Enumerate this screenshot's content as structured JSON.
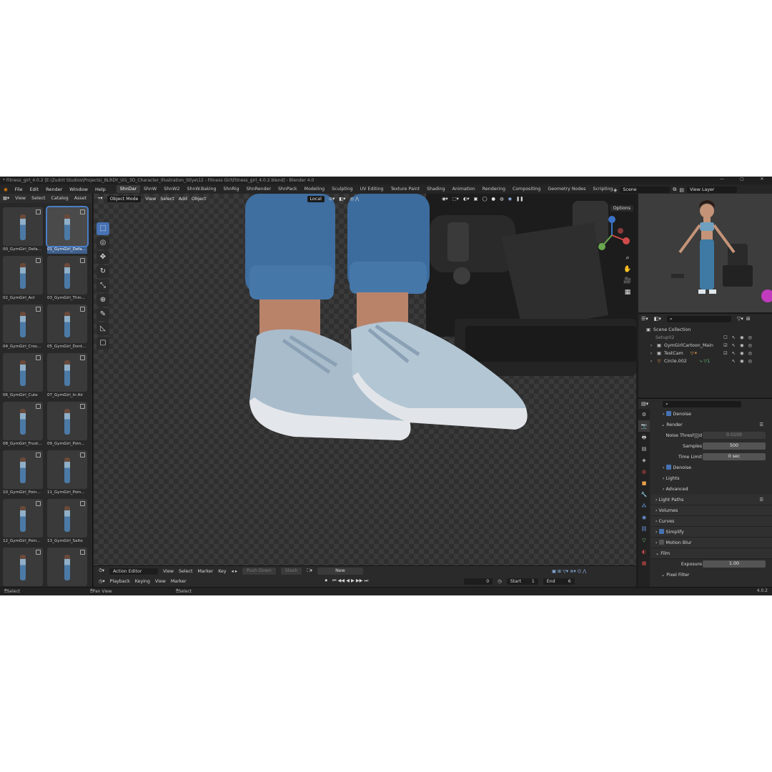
{
  "titlebar": {
    "title": "* Fitness_girl_4.0.2 [E:\\Zudrit Studios\\Projects\\_BLRDY_\\01_3D_Character_Illustration_Stlye\\12 - Fitness Girl\\Fitness_girl_4.0.2.blend] - Blender 4.0"
  },
  "menu": [
    "File",
    "Edit",
    "Render",
    "Window",
    "Help"
  ],
  "workspaces": [
    "ShnDar",
    "ShnW",
    "ShnW2",
    "ShnW.Baking",
    "ShnRig",
    "ShnRender",
    "ShnPack",
    "Modeling",
    "Sculpting",
    "UV Editing",
    "Texture Paint",
    "Shading",
    "Animation",
    "Rendering",
    "Compositing",
    "Geometry Nodes",
    "Scripting"
  ],
  "active_workspace": "ShnDar",
  "scene": {
    "scene_label": "Scene",
    "view_layer": "View Layer"
  },
  "asset_browser": {
    "menus": [
      "View",
      "Select",
      "Catalog",
      "Asset"
    ],
    "assets": [
      "00_GymGirl_Defa...",
      "01_GymGirl_Defa...",
      "02_GymGirl_Act",
      "03_GymGirl_Thin...",
      "04_GymGirl_Cros...",
      "05_GymGirl_Dont...",
      "06_GymGirl_Cute",
      "07_GymGirl_In Air",
      "08_GymGirl_Frust...",
      "09_GymGirl_Poin...",
      "10_GymGirl_Poin...",
      "11_GymGirl_Poin...",
      "12_GymGirl_Poin...",
      "13_GymGirl_Salto",
      "",
      ""
    ],
    "selected_index": 1
  },
  "viewport": {
    "mode": "Object Mode",
    "menus": [
      "View",
      "Select",
      "Add",
      "Object"
    ],
    "transform": "Local",
    "options": "Options"
  },
  "timeline": {
    "editor": "Action Editor",
    "menus": [
      "View",
      "Select",
      "Marker",
      "Key"
    ],
    "push_down": "Push Down",
    "stash": "Stash",
    "new": "New",
    "row2_menus": [
      "Playback",
      "Keying",
      "View",
      "Marker"
    ],
    "current_frame": "0",
    "start_label": "Start",
    "start": "1",
    "end_label": "End",
    "end": "6"
  },
  "outliner": {
    "root": "Scene Collection",
    "items": [
      "Setup02",
      "GymGirlCartoon_Main",
      "TestCam",
      "Circle.002"
    ]
  },
  "properties": {
    "rows": {
      "denoise1": "Denoise",
      "render": "Render",
      "noise_threshold_label": "Noise Threshold",
      "noise_threshold": "0.0100",
      "samples_label": "Samples",
      "samples": "500",
      "time_limit_label": "Time Limit",
      "time_limit": "0 sec",
      "denoise2": "Denoise",
      "lights": "Lights",
      "advanced": "Advanced",
      "light_paths": "Light Paths",
      "volumes": "Volumes",
      "curves": "Curves",
      "simplify": "Simplify",
      "motion_blur": "Motion Blur",
      "film": "Film",
      "exposure_label": "Exposure",
      "exposure": "1.00",
      "pixel_filter": "Pixel Filter"
    }
  },
  "statusbar": {
    "select": "Select",
    "pan": "Pan View",
    "select2": "Select",
    "version": "4.0.2"
  },
  "colors": {
    "accent": "#4772b3",
    "bg": "#1d1d1d",
    "panel": "#282828"
  }
}
